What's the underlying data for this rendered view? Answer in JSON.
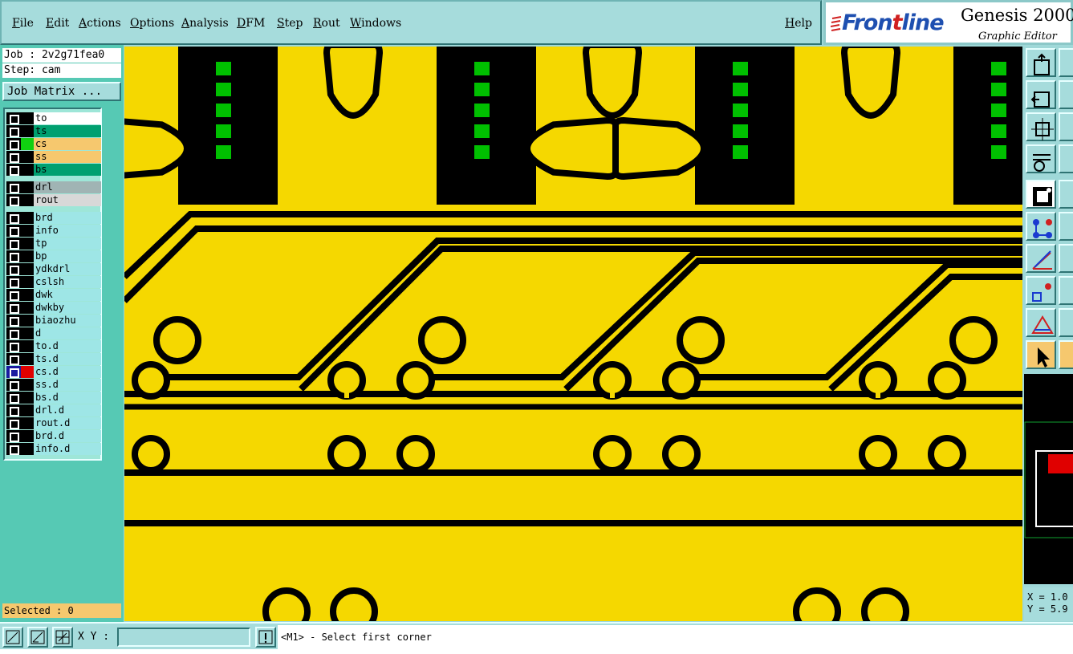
{
  "menu": [
    "File",
    "Edit",
    "Actions",
    "Options",
    "Analysis",
    "DFM",
    "Step",
    "Rout",
    "Windows"
  ],
  "help_label": "Help",
  "logo": {
    "brand": "Frontline",
    "product": "Genesis 2000",
    "subtitle": "Graphic Editor"
  },
  "job": "Job : 2v2g71fea0",
  "step": "Step: cam",
  "job_matrix_label": "Job Matrix ...",
  "layers": [
    {
      "name": "to",
      "bg": "#ffffff",
      "color": "#000000"
    },
    {
      "name": "ts",
      "bg": "#00a070",
      "color": "#000000"
    },
    {
      "name": "cs",
      "bg": "#f6c86e",
      "color": "#10d010"
    },
    {
      "name": "ss",
      "bg": "#f6c86e",
      "color": "#000000"
    },
    {
      "name": "bs",
      "bg": "#00a070",
      "color": "#000000"
    },
    {
      "name": "drl",
      "bg": "#a0b4b4",
      "color": "#000000"
    },
    {
      "name": "rout",
      "bg": "#d8d8d8",
      "color": "#000000"
    },
    {
      "name": "brd",
      "bg": "#9ee6e6",
      "color": "#000000"
    },
    {
      "name": "info",
      "bg": "#9ee6e6",
      "color": "#000000"
    },
    {
      "name": "tp",
      "bg": "#9ee6e6",
      "color": "#000000"
    },
    {
      "name": "bp",
      "bg": "#9ee6e6",
      "color": "#000000"
    },
    {
      "name": "ydkdrl",
      "bg": "#9ee6e6",
      "color": "#000000"
    },
    {
      "name": "cslsh",
      "bg": "#9ee6e6",
      "color": "#000000"
    },
    {
      "name": "dwk",
      "bg": "#9ee6e6",
      "color": "#000000"
    },
    {
      "name": "dwkby",
      "bg": "#9ee6e6",
      "color": "#000000"
    },
    {
      "name": "biaozhu",
      "bg": "#9ee6e6",
      "color": "#000000"
    },
    {
      "name": "d",
      "bg": "#9ee6e6",
      "color": "#000000"
    },
    {
      "name": "to.d",
      "bg": "#9ee6e6",
      "color": "#000000"
    },
    {
      "name": "ts.d",
      "bg": "#9ee6e6",
      "color": "#000000"
    },
    {
      "name": "cs.d",
      "bg": "#9ee6e6",
      "color": "#e00000"
    },
    {
      "name": "ss.d",
      "bg": "#9ee6e6",
      "color": "#000000"
    },
    {
      "name": "bs.d",
      "bg": "#9ee6e6",
      "color": "#000000"
    },
    {
      "name": "drl.d",
      "bg": "#9ee6e6",
      "color": "#000000"
    },
    {
      "name": "rout.d",
      "bg": "#9ee6e6",
      "color": "#000000"
    },
    {
      "name": "brd.d",
      "bg": "#9ee6e6",
      "color": "#000000"
    },
    {
      "name": "info.d",
      "bg": "#9ee6e6",
      "color": "#000000"
    }
  ],
  "selected": "Selected : 0",
  "coords": {
    "x": "X = 1.0",
    "y": "Y = 5.9"
  },
  "xy_label": "X Y :",
  "xy_value": "",
  "prompt": "<M1> - Select first corner",
  "colors": {
    "board": "#f5d800",
    "copper": "#000000",
    "pad": "#00c000",
    "panel": "#56c9b4",
    "menu": "#a6dcdc"
  }
}
